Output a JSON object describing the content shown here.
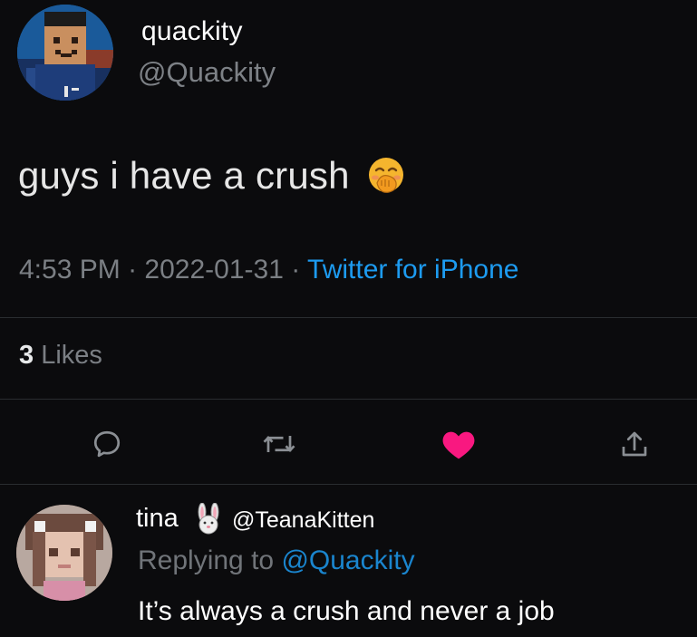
{
  "tweet": {
    "author_name": "quackity",
    "author_handle": "@Quackity",
    "text": "guys i have a crush",
    "emoji": "face-with-hand-over-mouth-emoji",
    "time": "4:53 PM",
    "date": "2022-01-31",
    "source": "Twitter for iPhone",
    "separator": "·",
    "likes_count": "3",
    "likes_label": "Likes"
  },
  "actions": {
    "reply": "reply-bubble-icon",
    "retweet": "retweet-icon",
    "like": "heart-icon",
    "share": "share-icon",
    "like_color": "#f91880",
    "icon_color": "#7b7f84"
  },
  "reply": {
    "author_name": "tina",
    "emoji": "rabbit-face-emoji",
    "author_handle": "@TeanaKitten",
    "replying_prefix": "Replying to",
    "replying_to": "@Quackity",
    "text": "It’s always a crush and never a job"
  },
  "colors": {
    "background": "#0b0b0d",
    "link": "#1d9bf0",
    "muted": "#7b7f84"
  }
}
